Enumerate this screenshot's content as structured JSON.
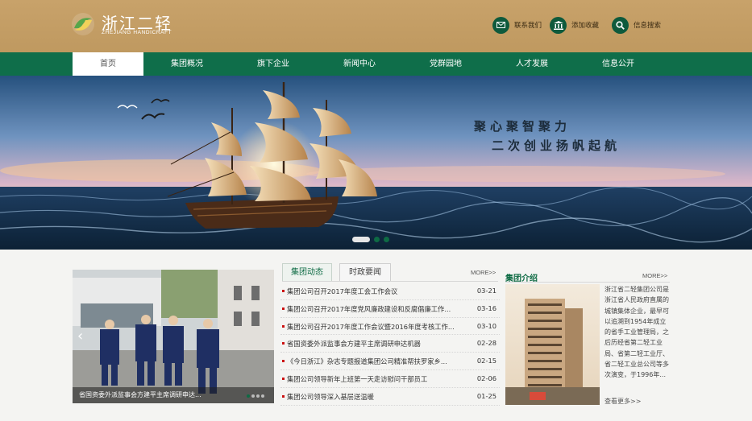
{
  "header": {
    "logo_cn": "浙江二轻",
    "logo_en": "ZHEJIANG HANDICRAFT",
    "tools": [
      {
        "label": "联系我们",
        "icon": "mail-icon"
      },
      {
        "label": "添加收藏",
        "icon": "bank-icon"
      },
      {
        "label": "信息搜索",
        "icon": "search-icon"
      }
    ]
  },
  "nav": {
    "items": [
      "首页",
      "集团概况",
      "旗下企业",
      "新闻中心",
      "党群园地",
      "人才发展",
      "信息公开"
    ],
    "active_index": 0
  },
  "banner": {
    "slogan_line1": "聚心聚智聚力",
    "slogan_line2": "二次创业扬帆起航",
    "slide_count": 3,
    "active_slide": 0
  },
  "photo": {
    "caption": "省国资委外派监事会方建平主席调研申达...",
    "dot_count": 4,
    "active_dot": 0
  },
  "news_tabs": {
    "tabs": [
      "集团动态",
      "时政要闻"
    ],
    "active_index": 0,
    "more": "MORE>>",
    "items": [
      {
        "title": "集团公司召开2017年度工会工作会议",
        "date": "03-21"
      },
      {
        "title": "集团公司召开2017年度党风廉政建设和反腐倡廉工作...",
        "date": "03-16"
      },
      {
        "title": "集团公司召开2017年度工作会议暨2016年度考核工作...",
        "date": "03-10"
      },
      {
        "title": "省国资委外派监事会方建平主席调研申达机器",
        "date": "02-28"
      },
      {
        "title": "《今日浙江》杂志专题报道集团公司精准帮扶罗家乡...",
        "date": "02-15"
      },
      {
        "title": "集团公司领导新年上班第一天走访慰问干部员工",
        "date": "02-06"
      },
      {
        "title": "集团公司领导深入基层送温暖",
        "date": "01-25"
      }
    ]
  },
  "intro": {
    "title": "集团介绍",
    "more": "MORE>>",
    "text": "浙江省二轻集团公司是浙江省人民政府直属的城镇集体企业，最早可以追溯到1954年成立的省手工业管理局，之后历经省第二轻工业局、省第二轻工业厅、省二轻工业总公司等多次演变，于1996年...",
    "read_more": "查看更多>>"
  },
  "colors": {
    "header_gold": "#c4a066",
    "brand_green": "#0f6e4a",
    "date_red": "#cc1111"
  }
}
